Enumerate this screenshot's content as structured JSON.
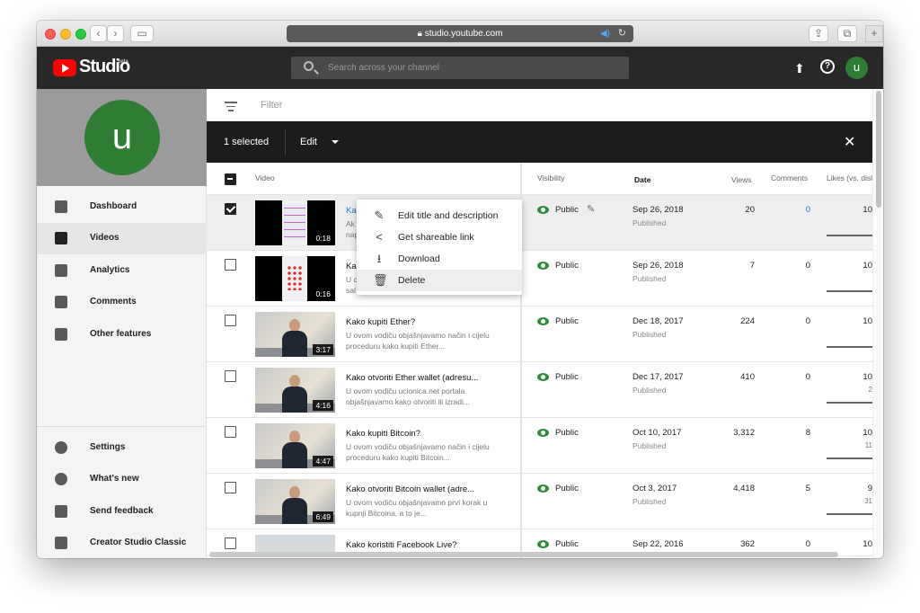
{
  "browser": {
    "url": "studio.youtube.com"
  },
  "header": {
    "logo_text": "Studio",
    "logo_badge": "beta",
    "search_placeholder": "Search across your channel",
    "avatar_letter": "u"
  },
  "sidebar": {
    "avatar_letter": "u",
    "items": [
      {
        "label": "Dashboard",
        "icon": "dashboard-icon"
      },
      {
        "label": "Videos",
        "icon": "videos-icon"
      },
      {
        "label": "Analytics",
        "icon": "analytics-icon"
      },
      {
        "label": "Comments",
        "icon": "comments-icon"
      },
      {
        "label": "Other features",
        "icon": "other-features-icon"
      }
    ],
    "bottom_items": [
      {
        "label": "Settings",
        "icon": "gear-icon"
      },
      {
        "label": "What's new",
        "icon": "whats-new-icon"
      },
      {
        "label": "Send feedback",
        "icon": "feedback-icon"
      },
      {
        "label": "Creator Studio Classic",
        "icon": "classic-icon"
      }
    ]
  },
  "filter": {
    "placeholder": "Filter"
  },
  "actionbar": {
    "selected_label": "1 selected",
    "edit_label": "Edit"
  },
  "table": {
    "headers": {
      "video": "Video",
      "visibility": "Visibility",
      "date": "Date",
      "views": "Views",
      "comments": "Comments",
      "likes": "Likes (vs. dislikes)"
    },
    "rows": [
      {
        "title": "Ka",
        "desc": "Ak\nnap",
        "duration": "0:18",
        "visibility": "Public",
        "date": "Sep 26, 2018",
        "status": "Published",
        "views": "20",
        "comments": "0",
        "likes": "10",
        "likes_sub": ""
      },
      {
        "title": "Ka",
        "desc": "U c\nsal",
        "duration": "0:16",
        "visibility": "Public",
        "date": "Sep 26, 2018",
        "status": "Published",
        "views": "7",
        "comments": "0",
        "likes": "10",
        "likes_sub": ""
      },
      {
        "title": "Kako kupiti Ether?",
        "desc": "U ovom vodiču objašnjavamo način i cijelu proceduru kako kupiti Ether...",
        "duration": "3:17",
        "visibility": "Public",
        "date": "Dec 18, 2017",
        "status": "Published",
        "views": "224",
        "comments": "0",
        "likes": "10",
        "likes_sub": ""
      },
      {
        "title": "Kako otvoriti Ether wallet (adresu...",
        "desc": "U ovom vodiču ucionica.net portala objašnjavamo kako otvoriti ili izradi...",
        "duration": "4:16",
        "visibility": "Public",
        "date": "Dec 17, 2017",
        "status": "Published",
        "views": "410",
        "comments": "0",
        "likes": "10",
        "likes_sub": "2"
      },
      {
        "title": "Kako kupiti Bitcoin?",
        "desc": "U ovom vodiču objašnjavamo način i cijelu proceduru kako kupiti Bitcoin...",
        "duration": "4:47",
        "visibility": "Public",
        "date": "Oct 10, 2017",
        "status": "Published",
        "views": "3,312",
        "comments": "8",
        "likes": "10",
        "likes_sub": "11"
      },
      {
        "title": "Kako otvoriti Bitcoin wallet (adre...",
        "desc": "U ovom vodiču objašnjavamo prvi korak u kupnji Bitcoina, a to je...",
        "duration": "6:49",
        "visibility": "Public",
        "date": "Oct 3, 2017",
        "status": "Published",
        "views": "4,418",
        "comments": "5",
        "likes": "9",
        "likes_sub": "31"
      },
      {
        "title": "Kako koristiti Facebook Live?",
        "desc": "",
        "duration": "",
        "visibility": "Public",
        "date": "Sep 22, 2016",
        "status": "",
        "views": "362",
        "comments": "0",
        "likes": "10",
        "likes_sub": ""
      }
    ]
  },
  "context_menu": {
    "items": [
      {
        "label": "Edit title and description",
        "icon": "pencil-icon"
      },
      {
        "label": "Get shareable link",
        "icon": "share-icon"
      },
      {
        "label": "Download",
        "icon": "download-icon"
      },
      {
        "label": "Delete",
        "icon": "trash-icon"
      }
    ]
  },
  "colors": {
    "accent_green": "#2e7d32",
    "brand_red": "#ff0000",
    "link_blue": "#1a73e8"
  }
}
